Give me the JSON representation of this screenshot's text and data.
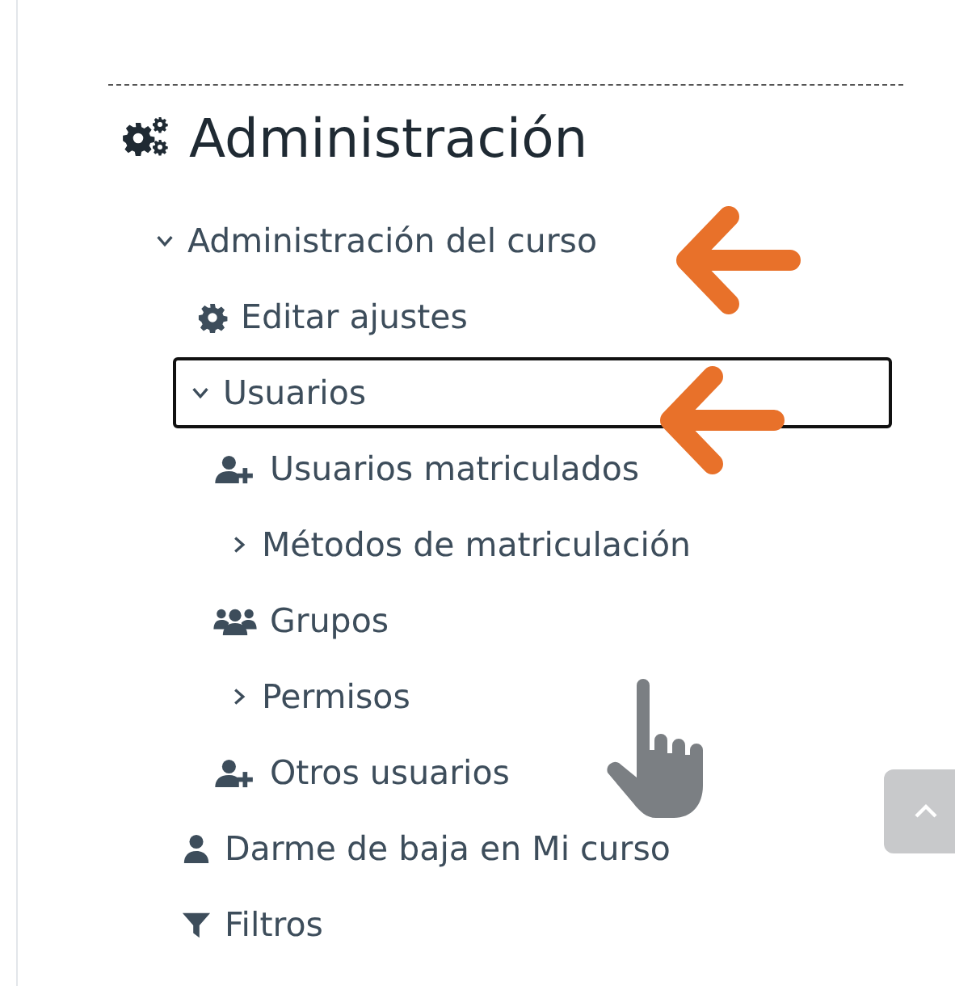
{
  "heading": "Administración",
  "tree": [
    {
      "label": "Administración del curso",
      "kind": "branch",
      "expanded": true,
      "selected": false,
      "children": [
        {
          "label": "Editar ajustes",
          "kind": "settings",
          "selected": false
        },
        {
          "label": "Usuarios",
          "kind": "branch",
          "expanded": true,
          "selected": true,
          "children": [
            {
              "label": "Usuarios matriculados",
              "kind": "enrol",
              "selected": false
            },
            {
              "label": "Métodos de matriculación",
              "kind": "branch",
              "expanded": false,
              "selected": false
            },
            {
              "label": "Grupos",
              "kind": "groups",
              "selected": false
            },
            {
              "label": "Permisos",
              "kind": "branch",
              "expanded": false,
              "selected": false
            },
            {
              "label": "Otros usuarios",
              "kind": "enrol",
              "selected": false
            }
          ]
        }
      ]
    },
    {
      "label": "Darme de baja en Mi curso",
      "kind": "person",
      "selected": false
    },
    {
      "label": "Filtros",
      "kind": "filter",
      "selected": false
    }
  ]
}
